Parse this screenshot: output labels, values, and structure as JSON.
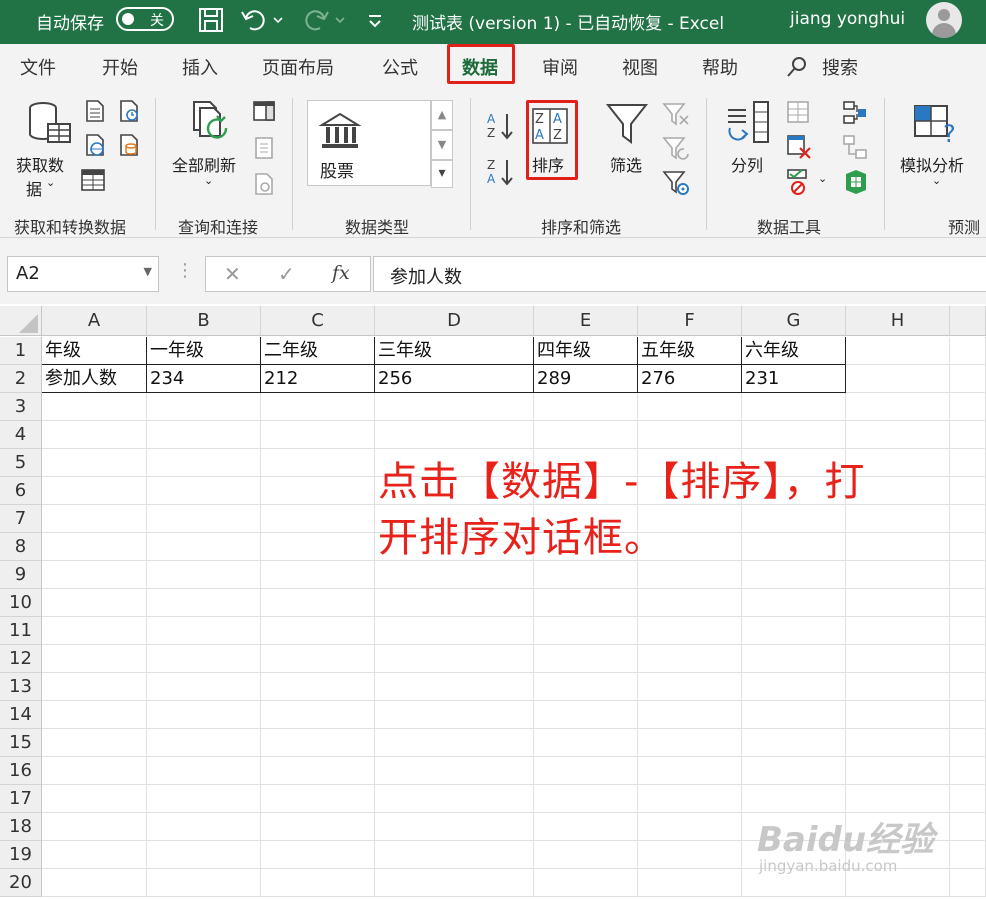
{
  "titlebar": {
    "autosave_label": "自动保存",
    "autosave_state": "关",
    "doc_title": "测试表 (version 1)  -  已自动恢复  -  Excel",
    "user_name": "jiang yonghui"
  },
  "tabs": [
    "文件",
    "开始",
    "插入",
    "页面布局",
    "公式",
    "数据",
    "审阅",
    "视图",
    "帮助"
  ],
  "search_label": "搜索",
  "ribbon": {
    "get_data": [
      "获取数",
      "据"
    ],
    "refresh_all": "全部刷新",
    "stock": "股票",
    "sort": "排序",
    "filter": "筛选",
    "text_to_columns": "分列",
    "what_if": "模拟分析",
    "groups": [
      "获取和转换数据",
      "查询和连接",
      "数据类型",
      "排序和筛选",
      "数据工具",
      "预测"
    ]
  },
  "formula_bar": {
    "name_box": "A2",
    "fx": "fx",
    "formula": "参加人数"
  },
  "sheet": {
    "columns": [
      "A",
      "B",
      "C",
      "D",
      "E",
      "F",
      "G",
      "H"
    ],
    "rows": [
      "1",
      "2",
      "3",
      "4",
      "5",
      "6",
      "7",
      "8",
      "9",
      "10",
      "11",
      "12",
      "13",
      "14",
      "15",
      "16",
      "17",
      "18",
      "19",
      "20"
    ],
    "data": [
      [
        "年级",
        "一年级",
        "二年级",
        "三年级",
        "四年级",
        "五年级",
        "六年级"
      ],
      [
        "参加人数",
        "234",
        "212",
        "256",
        "289",
        "276",
        "231"
      ]
    ]
  },
  "annotation": [
    "点击【数据】-【排序】，打",
    "开排序对话框。"
  ],
  "watermark": {
    "brand": "Baidu经验",
    "url": "jingyan.baidu.com"
  },
  "colors": {
    "excel_green": "#217346",
    "highlight_red": "#e0201b"
  }
}
